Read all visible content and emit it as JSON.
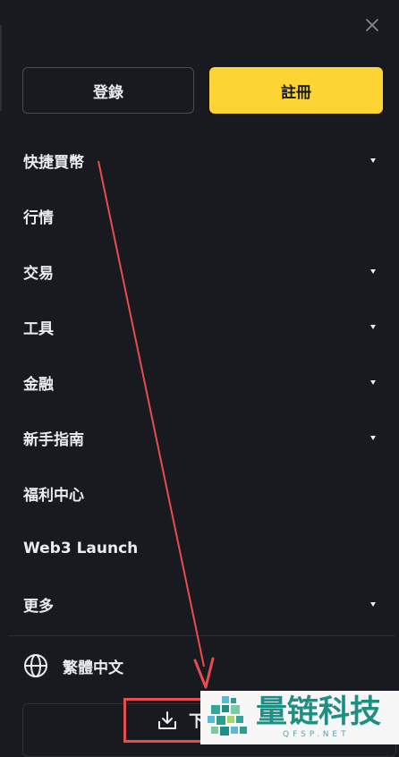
{
  "header": {
    "close_icon": "close-icon",
    "login_label": "登錄",
    "register_label": "註冊"
  },
  "colors": {
    "background": "#181a20",
    "accent": "#fcd535",
    "text": "#eaecef",
    "border": "#474d57",
    "annotation": "#e84c4c"
  },
  "menu": {
    "items": [
      {
        "label": "快捷買幣",
        "has_dropdown": true
      },
      {
        "label": "行情",
        "has_dropdown": false
      },
      {
        "label": "交易",
        "has_dropdown": true
      },
      {
        "label": "工具",
        "has_dropdown": true
      },
      {
        "label": "金融",
        "has_dropdown": true
      },
      {
        "label": "新手指南",
        "has_dropdown": true
      },
      {
        "label": "福利中心",
        "has_dropdown": false
      },
      {
        "label": "Web3 Launch",
        "has_dropdown": false
      },
      {
        "label": "更多",
        "has_dropdown": true
      }
    ]
  },
  "language": {
    "icon": "globe-icon",
    "label": "繁體中文"
  },
  "download": {
    "icon": "download-icon",
    "label": "下"
  },
  "watermark": {
    "title": "量链科技",
    "subtitle": "QFSP.NET"
  }
}
